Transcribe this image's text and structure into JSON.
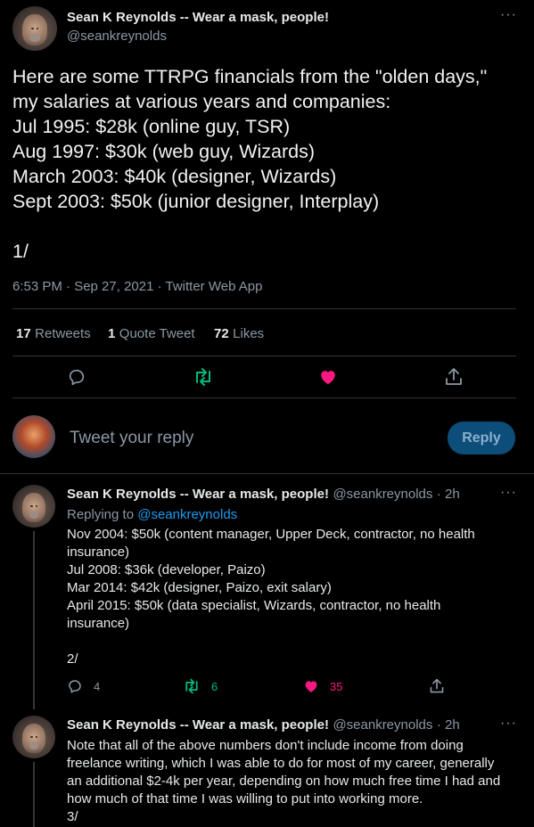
{
  "main_tweet": {
    "author_name": "Sean K Reynolds -- Wear a mask, people!",
    "author_handle": "@seankreynolds",
    "more": "···",
    "lines": [
      "Here are some TTRPG financials from the \"olden days,\"",
      "my salaries at various years and companies:",
      "Jul 1995: $28k (online guy, TSR)",
      "Aug 1997: $30k (web guy, Wizards)",
      "March 2003: $40k (designer, Wizards)",
      "Sept 2003: $50k (junior designer, Interplay)",
      "1/"
    ],
    "timestamp": "6:53 PM · Sep 27, 2021 · Twitter Web App",
    "stats": {
      "retweets_count": "17",
      "retweets_label": "Retweets",
      "quotes_count": "1",
      "quotes_label": "Quote Tweet",
      "likes_count": "72",
      "likes_label": "Likes"
    }
  },
  "composer": {
    "placeholder": "Tweet your reply",
    "button": "Reply"
  },
  "replies": [
    {
      "author_name": "Sean K Reynolds -- Wear a mask, people!",
      "author_handle": "@seankreynolds",
      "time": "· 2h",
      "replying_to_label": "Replying to",
      "replying_to_handle": "@seankreynolds",
      "lines": [
        "Nov 2004: $50k (content manager, Upper Deck, contractor, no health",
        "insurance)",
        "Jul 2008: $36k (developer, Paizo)",
        "Mar 2014: $42k (designer, Paizo, exit salary)",
        "April 2015: $50k (data specialist, Wizards, contractor, no health",
        "insurance)",
        "2/"
      ],
      "reply_count": "4",
      "retweet_count": "6",
      "like_count": "35"
    },
    {
      "author_name": "Sean K Reynolds -- Wear a mask, people!",
      "author_handle": "@seankreynolds",
      "time": "· 2h",
      "lines": [
        "Note that all of the above numbers don't include income from doing",
        "freelance writing, which I was able to do for most of my career, generally",
        "an additional $2-4k per year, depending on how much free time I had and",
        "how much of that time I was willing to put into working more.",
        "3/"
      ]
    }
  ],
  "colors": {
    "background": "#000000",
    "accent": "#1d9bf0",
    "retweet_green": "#00ba7c",
    "like_pink": "#f91880",
    "reply_button_bg": "#0c4d7a"
  },
  "icons": [
    "reply-icon",
    "retweet-icon",
    "like-icon",
    "share-icon",
    "more-icon"
  ]
}
